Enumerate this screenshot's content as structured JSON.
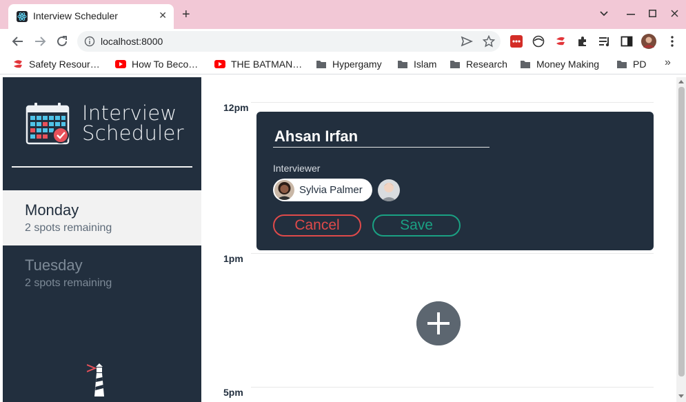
{
  "browser": {
    "tab_title": "Interview Scheduler",
    "tab_close_label": "✕",
    "new_tab_label": "+",
    "url": "localhost:8000",
    "bookmarks": [
      {
        "label": "Safety Resour…",
        "icon": "bookmark-red-icon"
      },
      {
        "label": "How To Beco…",
        "icon": "youtube-icon"
      },
      {
        "label": "THE BATMAN…",
        "icon": "youtube-icon"
      },
      {
        "label": "Hypergamy",
        "icon": "folder-icon"
      },
      {
        "label": "Islam",
        "icon": "folder-icon"
      },
      {
        "label": "Research",
        "icon": "folder-icon"
      },
      {
        "label": "Money Making",
        "icon": "folder-icon"
      },
      {
        "label": "PD",
        "icon": "folder-icon"
      }
    ],
    "bookmarks_more": "»"
  },
  "sidebar": {
    "logo_line1": "Interview",
    "logo_line2": "Scheduler",
    "days": [
      {
        "name": "Monday",
        "spots": "2 spots remaining",
        "selected": true
      },
      {
        "name": "Tuesday",
        "spots": "2 spots remaining",
        "selected": false
      }
    ]
  },
  "schedule": {
    "times": [
      "12pm",
      "1pm",
      "5pm"
    ]
  },
  "editor": {
    "student_name": "Ahsan Irfan",
    "interviewer_label": "Interviewer",
    "selected_interviewer": "Sylvia Palmer",
    "cancel_label": "Cancel",
    "save_label": "Save"
  },
  "colors": {
    "sidebar_bg": "#222f3e",
    "cancel": "#e04a4a",
    "save": "#1aa183",
    "tab_strip": "#f2c8d6"
  }
}
